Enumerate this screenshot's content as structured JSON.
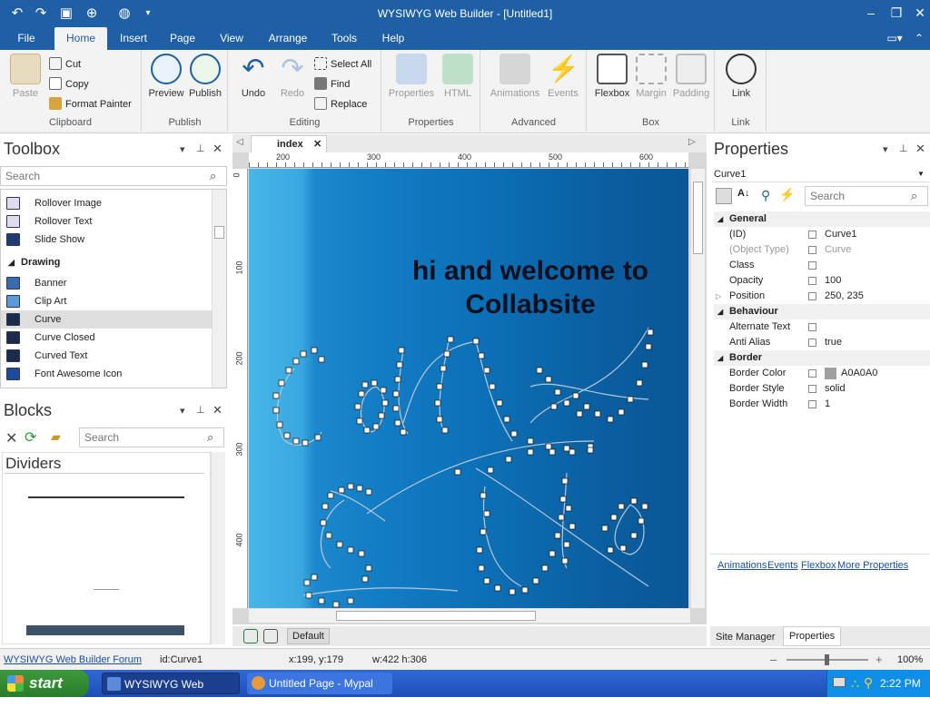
{
  "window": {
    "title": "WYSIWYG Web Builder - [Untitled1]"
  },
  "tabs": [
    "File",
    "Home",
    "Insert",
    "Page",
    "View",
    "Arrange",
    "Tools",
    "Help"
  ],
  "ribbon": {
    "clipboard": {
      "paste": "Paste",
      "cut": "Cut",
      "copy": "Copy",
      "format_painter": "Format Painter",
      "label": "Clipboard"
    },
    "publish": {
      "preview": "Preview",
      "publish": "Publish",
      "label": "Publish"
    },
    "editing": {
      "undo": "Undo",
      "redo": "Redo",
      "select_all": "Select All",
      "find": "Find",
      "replace": "Replace",
      "label": "Editing"
    },
    "properties": {
      "properties": "Properties",
      "html": "HTML",
      "label": "Properties"
    },
    "advanced": {
      "animations": "Animations",
      "events": "Events",
      "label": "Advanced"
    },
    "box": {
      "flexbox": "Flexbox",
      "margin": "Margin",
      "padding": "Padding",
      "label": "Box"
    },
    "link": {
      "link": "Link",
      "label": "Link"
    }
  },
  "toolbox": {
    "title": "Toolbox",
    "search_placeholder": "Search",
    "items_top": [
      "Rollover Image",
      "Rollover Text",
      "Slide Show"
    ],
    "category": "Drawing",
    "items": [
      "Banner",
      "Clip Art",
      "Curve",
      "Curve Closed",
      "Curved Text",
      "Font Awesome Icon"
    ]
  },
  "blocks": {
    "title": "Blocks",
    "search_placeholder": "Search",
    "category": "Dividers"
  },
  "editor": {
    "tab": "index",
    "ruler_h": [
      "200",
      "300",
      "400",
      "500",
      "600"
    ],
    "ruler_v": [
      "0",
      "100",
      "200",
      "300",
      "400"
    ],
    "heading_line1": "hi and welcome to",
    "heading_line2": "Collabsite",
    "bottom_tab": "Default"
  },
  "properties": {
    "title": "Properties",
    "object": "Curve1",
    "search_placeholder": "Search",
    "general": "General",
    "rows_general": [
      {
        "k": "(ID)",
        "v": "Curve1"
      },
      {
        "k": "(Object Type)",
        "v": "Curve"
      },
      {
        "k": "Class",
        "v": ""
      },
      {
        "k": "Opacity",
        "v": "100"
      },
      {
        "k": "Position",
        "v": "250, 235"
      }
    ],
    "behaviour": "Behaviour",
    "rows_behaviour": [
      {
        "k": "Alternate Text",
        "v": ""
      },
      {
        "k": "Anti Alias",
        "v": "true"
      }
    ],
    "border": "Border",
    "rows_border": [
      {
        "k": "Border Color",
        "v": "A0A0A0"
      },
      {
        "k": "Border Style",
        "v": "solid"
      },
      {
        "k": "Border Width",
        "v": "1"
      }
    ],
    "links": [
      "Animations",
      "Events",
      "Flexbox",
      "More Properties"
    ],
    "bottom_tabs": [
      "Site Manager",
      "Properties"
    ]
  },
  "status": {
    "forum": "WYSIWYG Web Builder Forum",
    "id": "id:Curve1",
    "xy": "x:199, y:179",
    "wh": "w:422 h:306",
    "zoom": "100%"
  },
  "taskbar": {
    "start": "start",
    "task1": "WYSIWYG Web Build...",
    "task2": "Untitled Page - Mypal",
    "clock": "2:22 PM"
  },
  "colors": {
    "accent": "#1e5fa6",
    "border_color_swatch": "#A0A0A0"
  }
}
